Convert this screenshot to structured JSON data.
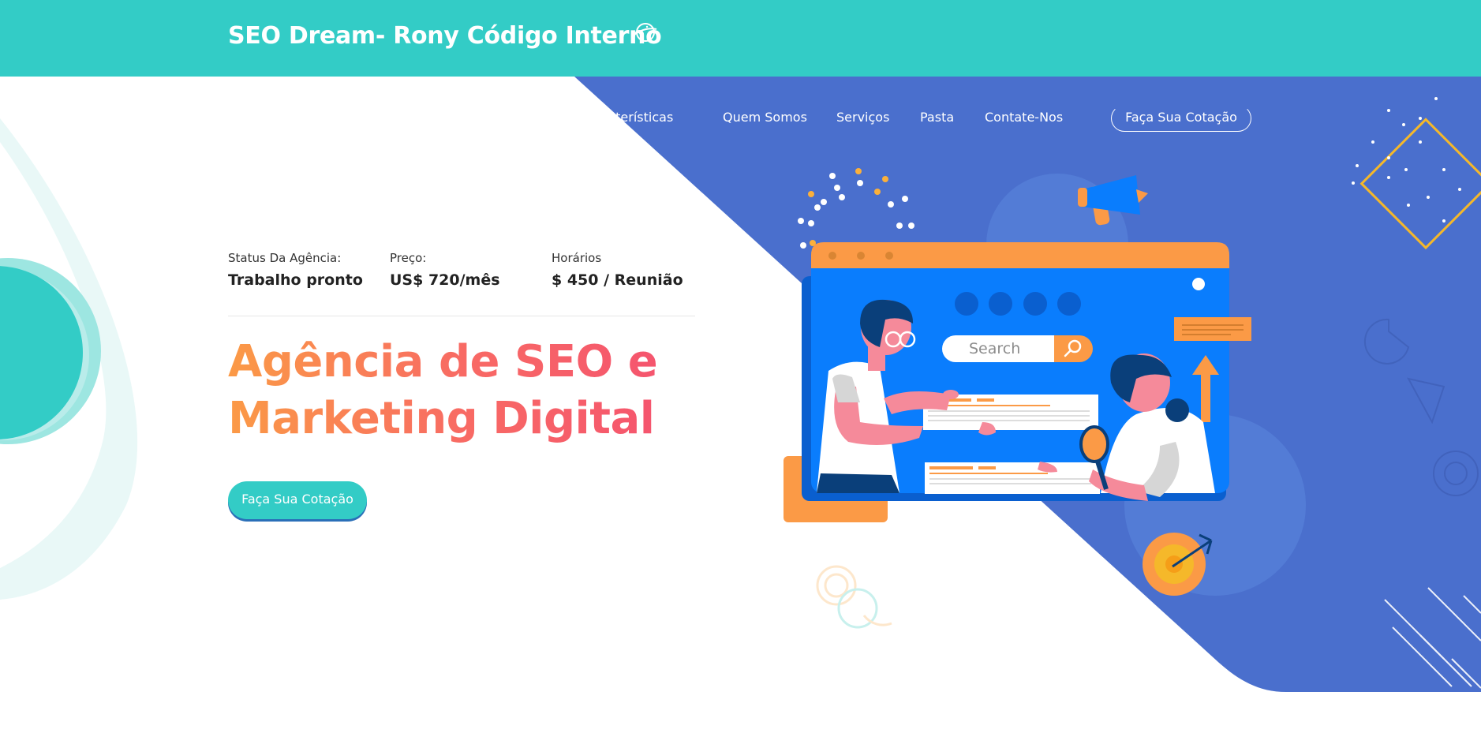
{
  "header": {
    "brand": "SEO Dream- Rony Código Interno",
    "brand_icon": "planet-doodle-icon",
    "background_color": "#33ccc6"
  },
  "nav": {
    "items": [
      {
        "label": "Características"
      },
      {
        "label": "Quem Somos"
      },
      {
        "label": "Serviços"
      },
      {
        "label": "Pasta"
      },
      {
        "label": "Contate-Nos"
      }
    ],
    "cta_label": "Faça Sua Cotação"
  },
  "stats": [
    {
      "label": "Status Da Agência:",
      "value": "Trabalho pronto"
    },
    {
      "label": "Preço:",
      "value": "US$ 720/mês"
    },
    {
      "label": "Horários",
      "value": "$ 450 / Reunião"
    }
  ],
  "hero": {
    "headline_line1": "Agência de SEO e",
    "headline_line2": "Marketing Digital",
    "cta_label": "Faça Sua Cotação"
  },
  "illustration": {
    "search_placeholder": "Search",
    "search_icon": "magnifier-icon",
    "icons": [
      "megaphone-icon",
      "magnifier-icon",
      "arrow-up-icon",
      "target-icon"
    ]
  },
  "colors": {
    "teal": "#33ccc6",
    "blue": "#4a6fcd",
    "orange": "#fb9a46",
    "pink": "#f5556e",
    "screen_blue": "#0a7dfd"
  }
}
